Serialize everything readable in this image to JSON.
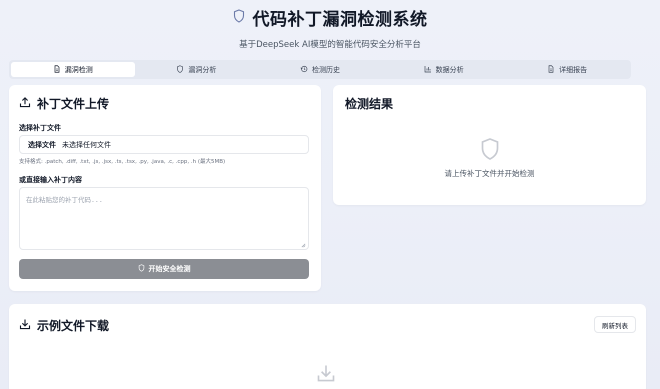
{
  "header": {
    "title": "代码补丁漏洞检测系统",
    "subtitle": "基于DeepSeek AI模型的智能代码安全分析平台",
    "logo_icon": "shield-icon"
  },
  "tabs": [
    {
      "label": "漏洞检测",
      "icon": "file-icon",
      "active": true
    },
    {
      "label": "漏洞分析",
      "icon": "shield-icon",
      "active": false
    },
    {
      "label": "检测历史",
      "icon": "history-icon",
      "active": false
    },
    {
      "label": "数据分析",
      "icon": "bar-chart-icon",
      "active": false
    },
    {
      "label": "详细报告",
      "icon": "file-text-icon",
      "active": false
    }
  ],
  "upload": {
    "title": "补丁文件上传",
    "file_label": "选择补丁文件",
    "file_button": "选择文件",
    "file_status": "未选择任何文件",
    "formats_hint": "支持格式: .patch, .diff, .txt, .js, .jsx, .ts, .tsx, .py, .java, .c, .cpp, .h (最大5MB)",
    "content_label": "或直接输入补丁内容",
    "content_placeholder": "在此粘贴您的补丁代码...",
    "submit_label": "开始安全检测"
  },
  "result": {
    "title": "检测结果",
    "empty_message": "请上传补丁文件并开始检测"
  },
  "samples": {
    "title": "示例文件下载",
    "refresh_label": "刷新列表"
  },
  "colors": {
    "accent": "#111827",
    "submit_disabled": "#8b8e94",
    "muted_icon": "#c7cad1"
  }
}
